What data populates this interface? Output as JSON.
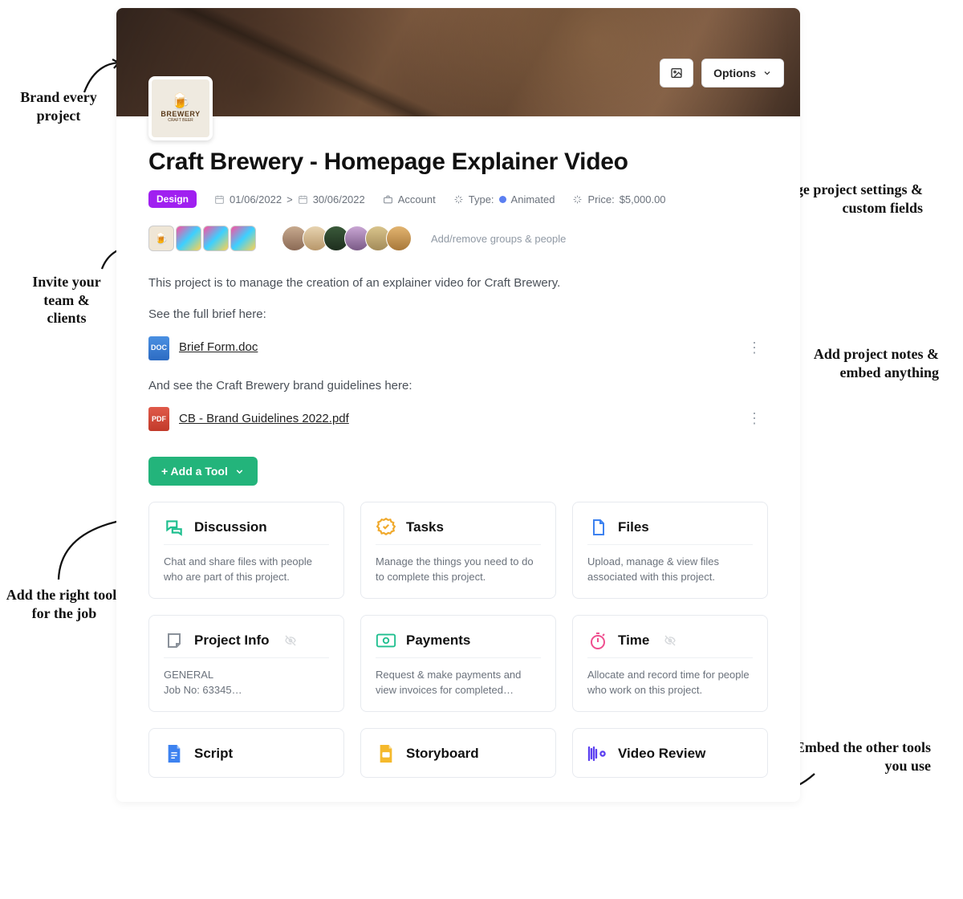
{
  "header": {
    "options_label": "Options"
  },
  "logo": {
    "name": "BREWERY",
    "sub": "CRAFT BEER"
  },
  "title": "Craft Brewery - Homepage Explainer Video",
  "tag": "Design",
  "meta": {
    "date_start": "01/06/2022",
    "date_sep": ">",
    "date_end": "30/06/2022",
    "account_label": "Account",
    "type_label": "Type:",
    "type_value": "Animated",
    "price_label": "Price:",
    "price_value": "$5,000.00"
  },
  "people": {
    "add_label": "Add/remove groups & people"
  },
  "description": {
    "line1": "This project is to manage the creation of an explainer video for Craft Brewery.",
    "line2": "See the full brief here:",
    "file1": "Brief Form.doc",
    "line3": "And see the Craft Brewery brand guidelines here:",
    "file2": "CB - Brand Guidelines 2022.pdf"
  },
  "add_tool_label": "+ Add a Tool",
  "tools": [
    {
      "title": "Discussion",
      "desc": "Chat and share files with people who are part of this project."
    },
    {
      "title": "Tasks",
      "desc": "Manage the things you need to do to complete this project."
    },
    {
      "title": "Files",
      "desc": "Upload, manage & view files associated with this project."
    },
    {
      "title": "Project Info",
      "desc": "GENERAL\nJob No: 63345…",
      "hidden": true
    },
    {
      "title": "Payments",
      "desc": "Request & make payments and view invoices for completed…"
    },
    {
      "title": "Time",
      "desc": "Allocate and record time for people who work on this project.",
      "hidden": true
    },
    {
      "title": "Script"
    },
    {
      "title": "Storyboard"
    },
    {
      "title": "Video Review"
    }
  ],
  "annotations": {
    "brand": "Brand every project",
    "invite": "Invite your team & clients",
    "tools": "Add the right tools for the job",
    "settings": "Manage project settings & custom fields",
    "notes": "Add project notes & embed anything",
    "embed": "Embed the other tools you use"
  }
}
